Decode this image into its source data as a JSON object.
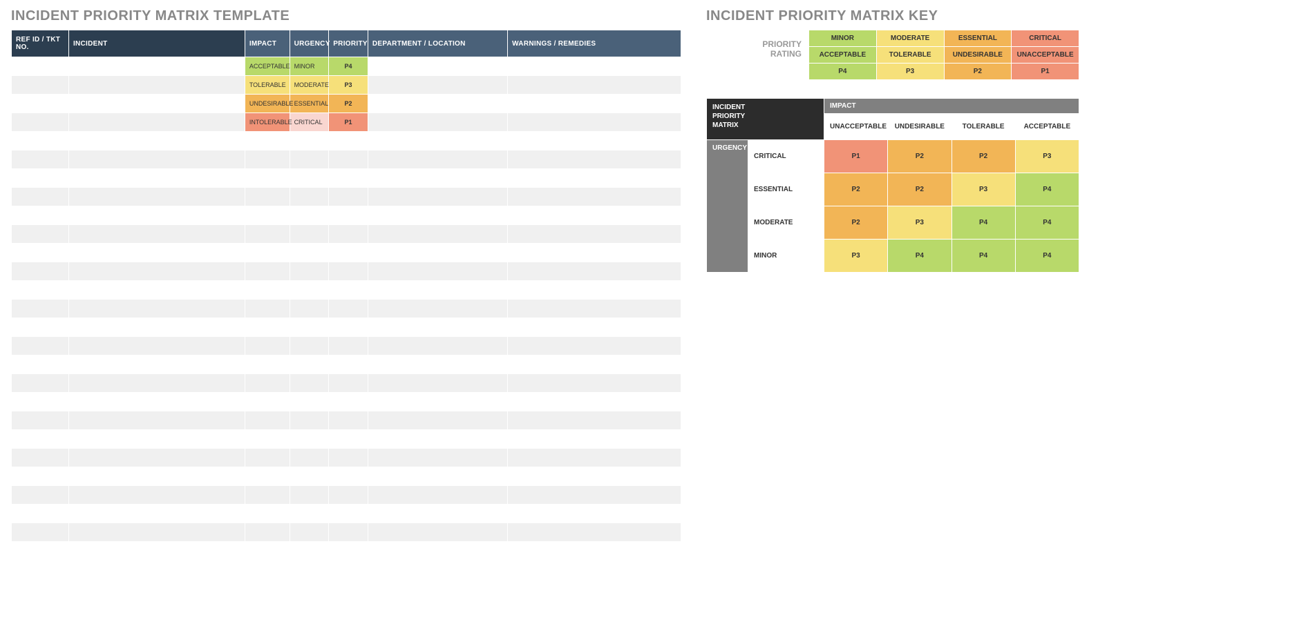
{
  "left": {
    "title": "INCIDENT PRIORITY MATRIX TEMPLATE",
    "headers": {
      "ref": "REF ID / TKT NO.",
      "incident": "INCIDENT",
      "impact": "IMPACT",
      "urgency": "URGENCY",
      "priority": "PRIORITY",
      "dept": "DEPARTMENT / LOCATION",
      "warn": "WARNINGS / REMEDIES"
    },
    "rows": [
      {
        "impact": "ACCEPTABLE",
        "urgency": "MINOR",
        "priority": "P4",
        "impCls": "c-green",
        "urgCls": "c-green",
        "priCls": "c-green"
      },
      {
        "impact": "TOLERABLE",
        "urgency": "MODERATE",
        "priority": "P3",
        "impCls": "c-yellow",
        "urgCls": "c-yellow",
        "priCls": "c-yellow"
      },
      {
        "impact": "UNDESIRABLE",
        "urgency": "ESSENTIAL",
        "priority": "P2",
        "impCls": "c-orange",
        "urgCls": "c-orange",
        "priCls": "c-orange"
      },
      {
        "impact": "INTOLERABLE",
        "urgency": "CRITICAL",
        "priority": "P1",
        "impCls": "c-salmon",
        "urgCls": "c-pink",
        "priCls": "c-salmon"
      }
    ],
    "blank_rows": 22
  },
  "right": {
    "title": "INCIDENT PRIORITY MATRIX KEY",
    "priority_label": "PRIORITY\nRATING",
    "key1": {
      "row1": [
        {
          "txt": "MINOR",
          "cls": "c-green"
        },
        {
          "txt": "MODERATE",
          "cls": "c-yellow"
        },
        {
          "txt": "ESSENTIAL",
          "cls": "c-orange"
        },
        {
          "txt": "CRITICAL",
          "cls": "c-salmon"
        }
      ],
      "row2": [
        {
          "txt": "ACCEPTABLE",
          "cls": "c-green"
        },
        {
          "txt": "TOLERABLE",
          "cls": "c-yellow"
        },
        {
          "txt": "UNDESIRABLE",
          "cls": "c-orange"
        },
        {
          "txt": "UNACCEPTABLE",
          "cls": "c-salmon"
        }
      ],
      "row3": [
        {
          "txt": "P4",
          "cls": "c-green"
        },
        {
          "txt": "P3",
          "cls": "c-yellow"
        },
        {
          "txt": "P2",
          "cls": "c-orange"
        },
        {
          "txt": "P1",
          "cls": "c-salmon"
        }
      ]
    },
    "key2": {
      "corner": "INCIDENT\nPRIORITY\nMATRIX",
      "impact_label": "IMPACT",
      "urgency_label": "URGENCY",
      "impact_levels": [
        "UNACCEPTABLE",
        "UNDESIRABLE",
        "TOLERABLE",
        "ACCEPTABLE"
      ],
      "rows": [
        {
          "name": "CRITICAL",
          "cells": [
            {
              "p": "P1",
              "cls": "c-salmon"
            },
            {
              "p": "P2",
              "cls": "c-orange"
            },
            {
              "p": "P2",
              "cls": "c-orange"
            },
            {
              "p": "P3",
              "cls": "c-yellow"
            }
          ]
        },
        {
          "name": "ESSENTIAL",
          "cells": [
            {
              "p": "P2",
              "cls": "c-orange"
            },
            {
              "p": "P2",
              "cls": "c-orange"
            },
            {
              "p": "P3",
              "cls": "c-yellow"
            },
            {
              "p": "P4",
              "cls": "c-green"
            }
          ]
        },
        {
          "name": "MODERATE",
          "cells": [
            {
              "p": "P2",
              "cls": "c-orange"
            },
            {
              "p": "P3",
              "cls": "c-yellow"
            },
            {
              "p": "P4",
              "cls": "c-green"
            },
            {
              "p": "P4",
              "cls": "c-green"
            }
          ]
        },
        {
          "name": "MINOR",
          "cells": [
            {
              "p": "P3",
              "cls": "c-yellow"
            },
            {
              "p": "P4",
              "cls": "c-green"
            },
            {
              "p": "P4",
              "cls": "c-green"
            },
            {
              "p": "P4",
              "cls": "c-green"
            }
          ]
        }
      ]
    }
  }
}
